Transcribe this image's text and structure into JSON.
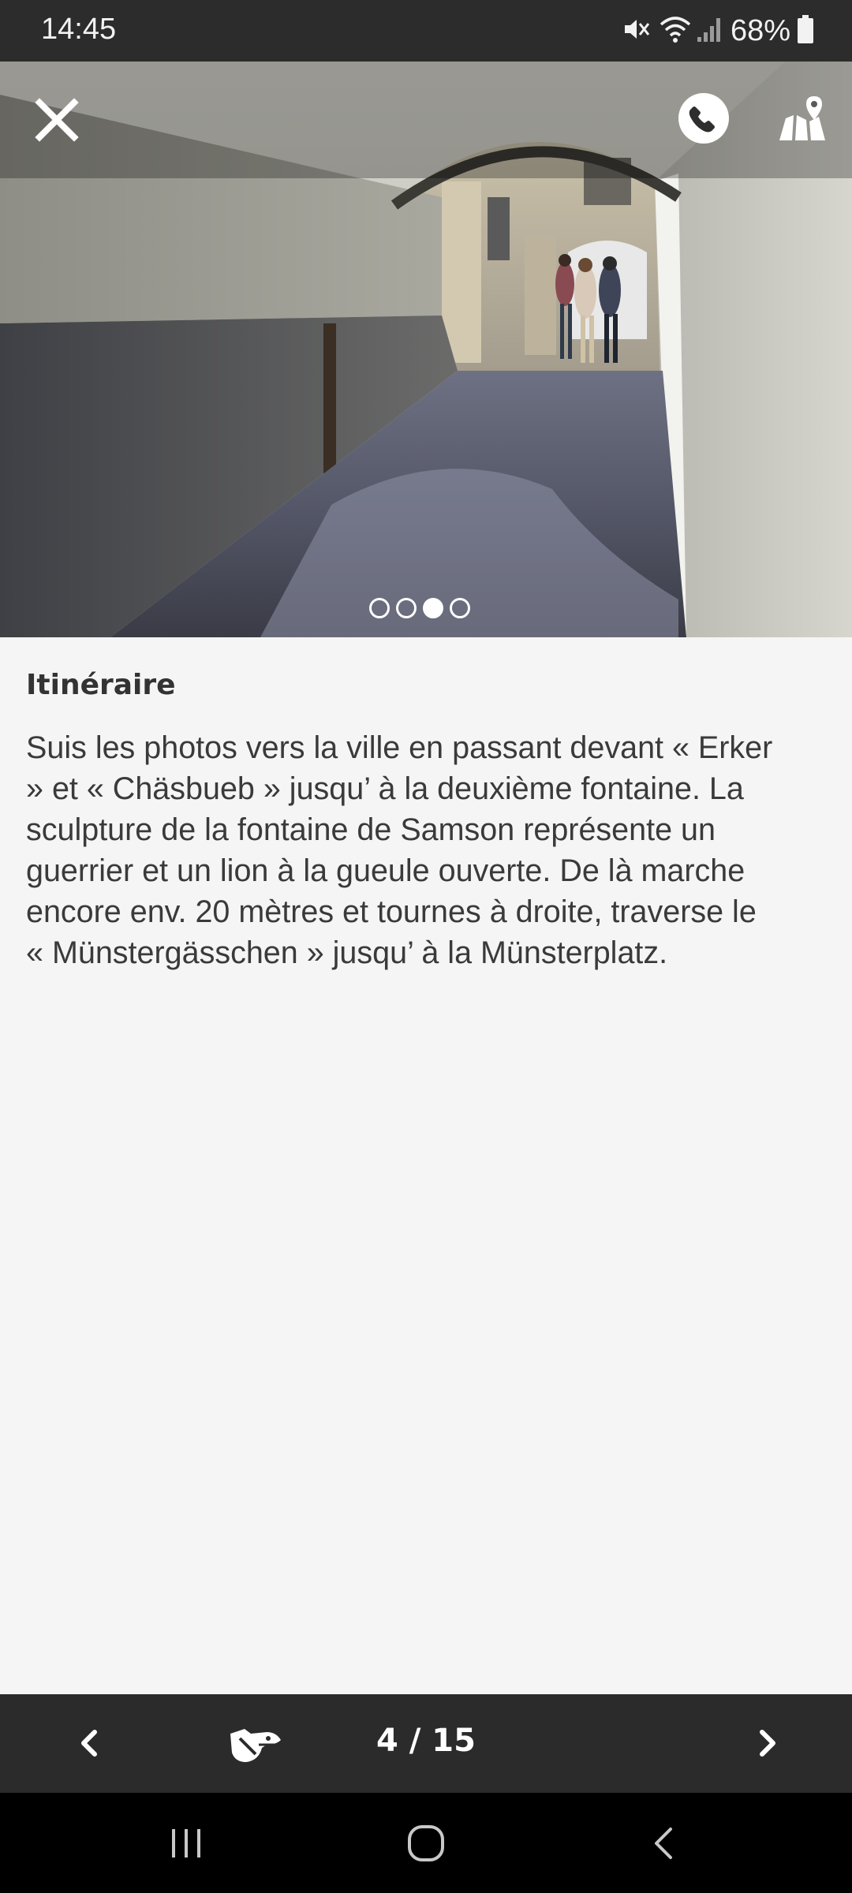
{
  "status_bar": {
    "time": "14:45",
    "battery_percent": "68%",
    "icons": [
      "mute-icon",
      "wifi-icon",
      "signal-icon",
      "battery-icon"
    ]
  },
  "toolbar": {
    "icons": [
      "close-icon",
      "phone-icon",
      "map-icon"
    ]
  },
  "carousel": {
    "total_dots": 4,
    "active_index": 2
  },
  "section": {
    "title": "Itinéraire",
    "body_lines": [
      "Suis les photos vers la ville en passant devant « Erker",
      "» et « Chäsbueb » jusqu’ à la deuxième fontaine. La",
      "sculpture de la fontaine de Samson représente un",
      "guerrier et un lion à la gueule ouverte. De là marche",
      "encore env. 20 mètres et tournes à droite, traverse le",
      "« Münstergässchen » jusqu’ à la Münsterplatz."
    ]
  },
  "bottom_nav": {
    "counter": "4 / 15",
    "icons": [
      "chevron-left-icon",
      "game-icon",
      "chevron-right-icon"
    ]
  },
  "system_nav": {
    "icons": [
      "recent-apps-icon",
      "home-icon",
      "back-icon"
    ]
  },
  "colors": {
    "bar_dark": "#2b2b2b",
    "background": "#f5f5f5",
    "text": "#3a3a3a"
  }
}
